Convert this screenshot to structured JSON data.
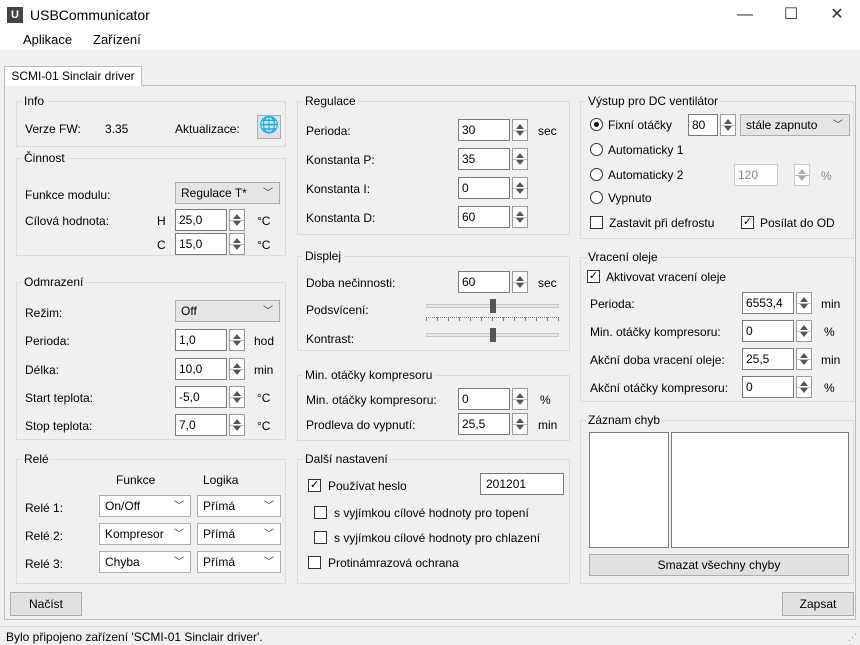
{
  "app": {
    "title": "USBCommunicator",
    "icon_letter": "U"
  },
  "window_controls": {
    "minimize": "—",
    "maximize": "☐",
    "close": "✕"
  },
  "menu": [
    "Aplikace",
    "Zařízení"
  ],
  "tab": "SCMI-01 Sinclair driver",
  "info": {
    "title": "Info",
    "fw_label": "Verze FW:",
    "fw_value": "3.35",
    "update_label": "Aktualizace:",
    "update_icon": "globe-icon"
  },
  "cinnost": {
    "title": "Činnost",
    "func_label": "Funkce modulu:",
    "func_value": "Regulace T*",
    "target_label": "Cílová hodnota:",
    "h_label": "H",
    "h_value": "25,0",
    "c_label": "C",
    "c_value": "15,0",
    "unit": "°C"
  },
  "odmrazeni": {
    "title": "Odmrazení",
    "mode_label": "Režim:",
    "mode_value": "Off",
    "period_label": "Perioda:",
    "period_value": "1,0",
    "period_unit": "hod",
    "length_label": "Délka:",
    "length_value": "10,0",
    "length_unit": "min",
    "start_label": "Start teplota:",
    "start_value": "-5,0",
    "start_unit": "°C",
    "stop_label": "Stop teplota:",
    "stop_value": "7,0",
    "stop_unit": "°C"
  },
  "rele": {
    "title": "Relé",
    "col_funkce": "Funkce",
    "col_logika": "Logika",
    "rows": [
      {
        "label": "Relé 1:",
        "funkce": "On/Off",
        "logika": "Přímá"
      },
      {
        "label": "Relé 2:",
        "funkce": "Kompresor",
        "logika": "Přímá"
      },
      {
        "label": "Relé 3:",
        "funkce": "Chyba",
        "logika": "Přímá"
      }
    ]
  },
  "regulace": {
    "title": "Regulace",
    "perioda_label": "Perioda:",
    "perioda_value": "30",
    "perioda_unit": "sec",
    "kp_label": "Konstanta P:",
    "kp_value": "35",
    "ki_label": "Konstanta I:",
    "ki_value": "0",
    "kd_label": "Konstanta D:",
    "kd_value": "60"
  },
  "displej": {
    "title": "Displej",
    "idle_label": "Doba nečinnosti:",
    "idle_value": "60",
    "idle_unit": "sec",
    "backlight_label": "Podsvícení:",
    "backlight_level": 0.5,
    "contrast_label": "Kontrast:",
    "contrast_level": 0.5
  },
  "minot": {
    "title": "Min. otáčky kompresoru",
    "min_label": "Min. otáčky kompresoru:",
    "min_value": "0",
    "min_unit": "%",
    "delay_label": "Prodleva do vypnutí:",
    "delay_value": "25,5",
    "delay_unit": "min"
  },
  "dalsi": {
    "title": "Další nastavení",
    "heslo_label": "Používat heslo",
    "heslo_value": "201201",
    "heslo_checked": true,
    "topeni_label": "s vyjímkou cílové hodnoty pro topení",
    "chlazeni_label": "s vyjímkou cílové hodnoty pro chlazení",
    "proti_label": "Protinámrazová ochrana"
  },
  "vystup": {
    "title": "Výstup pro DC ventilátor",
    "fixni_label": "Fixní otáčky",
    "fixni_value": "80",
    "fixni_mode": "stále zapnuto",
    "auto1_label": "Automaticky 1",
    "auto2_label": "Automaticky 2",
    "auto2_value": "120",
    "auto2_unit": "%",
    "vypnuto_label": "Vypnuto",
    "zastavit_label": "Zastavit při defrostu",
    "posilat_label": "Posílat do OD"
  },
  "vraceni": {
    "title": "Vracení oleje",
    "activate_label": "Aktivovat vracení oleje",
    "perioda_label": "Perioda:",
    "perioda_value": "6553,4",
    "perioda_unit": "min",
    "minot_label": "Min. otáčky kompresoru:",
    "minot_value": "0",
    "minot_unit": "%",
    "doba_label": "Akční doba vracení oleje:",
    "doba_value": "25,5",
    "doba_unit": "min",
    "akcni_label": "Akční otáčky kompresoru:",
    "akcni_value": "0",
    "akcni_unit": "%"
  },
  "zaznam": {
    "title": "Záznam chyb",
    "clear_label": "Smazat všechny chyby"
  },
  "buttons": {
    "load": "Načíst",
    "save": "Zapsat"
  },
  "status": "Bylo připojeno zařízení 'SCMI-01 Sinclair driver'."
}
